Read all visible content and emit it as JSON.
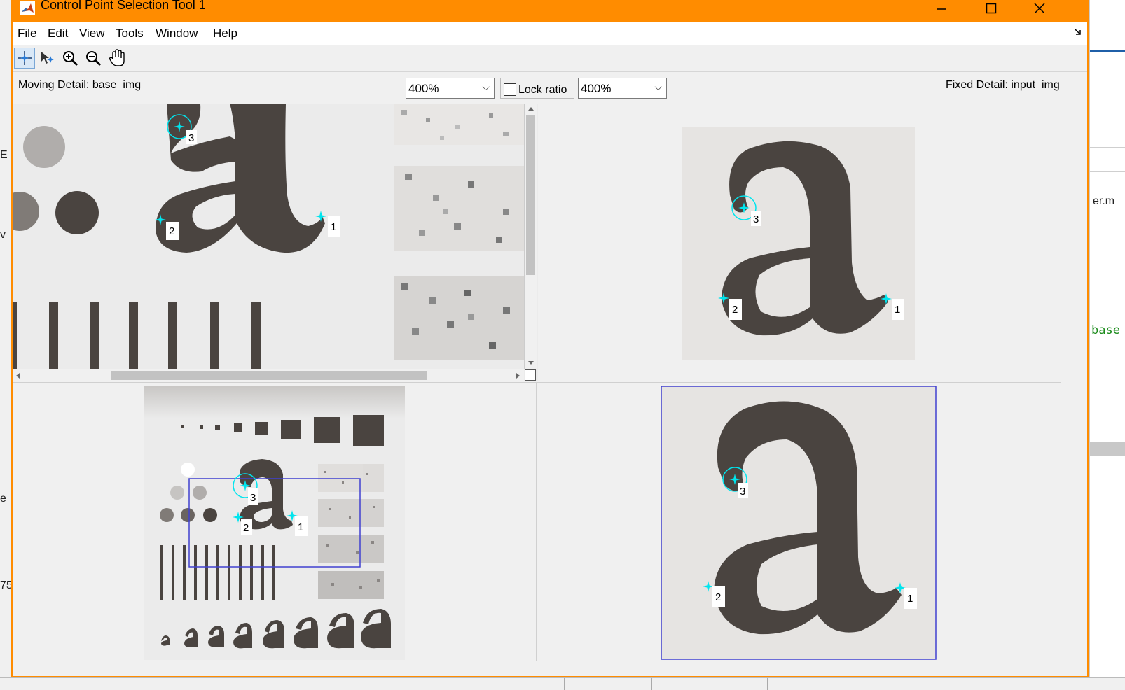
{
  "window": {
    "title": "Control Point Selection Tool 1",
    "minimize_icon": "minimize-icon",
    "maximize_icon": "maximize-icon",
    "close_icon": "close-icon"
  },
  "menu": [
    "File",
    "Edit",
    "View",
    "Tools",
    "Window",
    "Help"
  ],
  "toolbar": {
    "tools": [
      "add-point-icon",
      "select-point-icon",
      "zoom-in-icon",
      "zoom-out-icon",
      "pan-hand-icon"
    ],
    "active": "add-point-icon"
  },
  "controls": {
    "moving_label": "Moving Detail: base_img",
    "moving_zoom": "400%",
    "lock_ratio_label": "Lock ratio",
    "lock_ratio_checked": false,
    "fixed_zoom": "400%",
    "fixed_label": "Fixed Detail: input_img"
  },
  "points": {
    "labels": [
      "1",
      "2",
      "3"
    ]
  },
  "background": {
    "right_text_1": "er.m",
    "right_text_2": "base",
    "left_chars": [
      "E",
      "v",
      "e",
      "75"
    ]
  },
  "colors": {
    "title_bar": "#ff8c00",
    "point": "#00e5ee",
    "glyph": "#4a4440",
    "selection_box": "#4040d0"
  }
}
